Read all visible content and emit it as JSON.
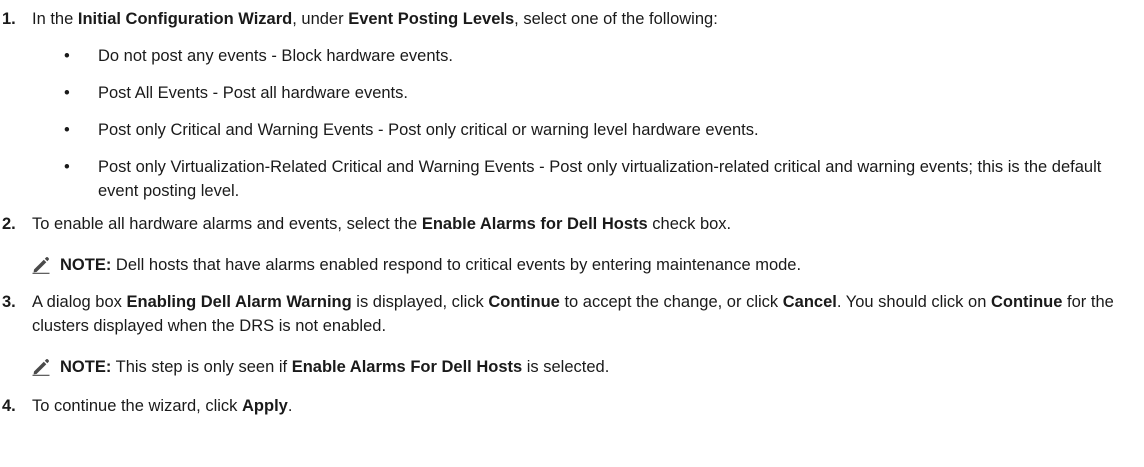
{
  "steps": [
    {
      "num": "1.",
      "parts": [
        {
          "t": "In the "
        },
        {
          "t": "Initial Configuration Wizard",
          "b": true
        },
        {
          "t": ", under "
        },
        {
          "t": "Event Posting Levels",
          "b": true
        },
        {
          "t": ", select one of the following:"
        }
      ],
      "bullets": [
        "Do not post any events - Block hardware events.",
        "Post All Events - Post all hardware events.",
        "Post only Critical and Warning Events - Post only critical or warning level hardware events.",
        "Post only Virtualization-Related Critical and Warning Events - Post only virtualization-related critical and warning events; this is the default event posting level."
      ]
    },
    {
      "num": "2.",
      "parts": [
        {
          "t": "To enable all hardware alarms and events, select the "
        },
        {
          "t": "Enable Alarms for Dell Hosts",
          "b": true
        },
        {
          "t": " check box."
        }
      ],
      "note": [
        {
          "t": "NOTE:",
          "b": true
        },
        {
          "t": " Dell hosts that have alarms enabled respond to critical events by entering maintenance mode."
        }
      ]
    },
    {
      "num": "3.",
      "parts": [
        {
          "t": "A dialog box "
        },
        {
          "t": "Enabling Dell Alarm Warning",
          "b": true
        },
        {
          "t": " is displayed, click "
        },
        {
          "t": "Continue",
          "b": true
        },
        {
          "t": " to accept the change, or click "
        },
        {
          "t": "Cancel",
          "b": true
        },
        {
          "t": ". You should click on "
        },
        {
          "t": "Continue",
          "b": true
        },
        {
          "t": " for the clusters displayed when the DRS is not enabled."
        }
      ],
      "note": [
        {
          "t": "NOTE:",
          "b": true
        },
        {
          "t": " This step is only seen if "
        },
        {
          "t": "Enable Alarms For Dell Hosts",
          "b": true
        },
        {
          "t": " is selected."
        }
      ]
    },
    {
      "num": "4.",
      "parts": [
        {
          "t": "To continue the wizard, click "
        },
        {
          "t": "Apply",
          "b": true
        },
        {
          "t": "."
        }
      ]
    }
  ],
  "bullet_glyph": "•",
  "note_icon": "pencil-note-icon"
}
